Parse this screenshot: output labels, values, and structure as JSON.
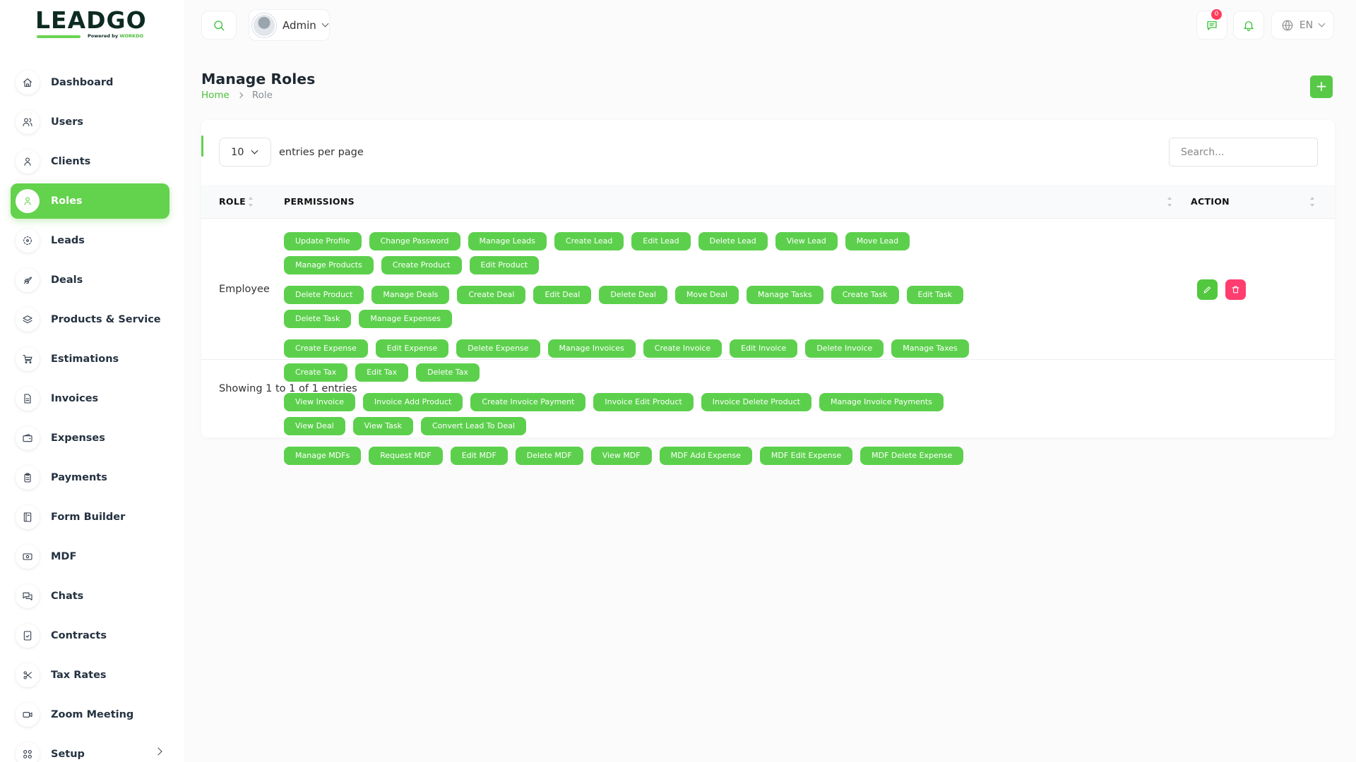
{
  "logo": {
    "brand": "LEADGO",
    "tagline_prefix": "Powered by ",
    "tagline_brand": "WORKDO"
  },
  "header": {
    "user_name": "Admin",
    "message_count": "0",
    "language": "EN"
  },
  "sidebar": {
    "items": [
      {
        "label": "Dashboard",
        "icon": "home-icon"
      },
      {
        "label": "Users",
        "icon": "users-icon"
      },
      {
        "label": "Clients",
        "icon": "user-icon"
      },
      {
        "label": "Roles",
        "icon": "user-check-icon",
        "active": true
      },
      {
        "label": "Leads",
        "icon": "target-icon"
      },
      {
        "label": "Deals",
        "icon": "rocket-icon"
      },
      {
        "label": "Products & Service",
        "icon": "layers-icon"
      },
      {
        "label": "Estimations",
        "icon": "cart-icon"
      },
      {
        "label": "Invoices",
        "icon": "file-icon"
      },
      {
        "label": "Expenses",
        "icon": "wallet-icon"
      },
      {
        "label": "Payments",
        "icon": "clipboard-icon"
      },
      {
        "label": "Form Builder",
        "icon": "book-icon"
      },
      {
        "label": "MDF",
        "icon": "money-icon"
      },
      {
        "label": "Chats",
        "icon": "chat-icon"
      },
      {
        "label": "Contracts",
        "icon": "contract-icon"
      },
      {
        "label": "Tax Rates",
        "icon": "scissors-icon"
      },
      {
        "label": "Zoom Meeting",
        "icon": "video-icon"
      },
      {
        "label": "Setup",
        "icon": "grid-icon"
      }
    ]
  },
  "page": {
    "title": "Manage Roles",
    "breadcrumb_home": "Home",
    "breadcrumb_current": "Role",
    "add_label": "+"
  },
  "table": {
    "page_size": "10",
    "entries_label": "entries per page",
    "search_placeholder": "Search...",
    "columns": [
      "ROLE",
      "PERMISSIONS",
      "ACTION"
    ],
    "rows": [
      {
        "role": "Employee",
        "permissions": [
          "Update Profile",
          "Change Password",
          "Manage Leads",
          "Create Lead",
          "Edit Lead",
          "Delete Lead",
          "View Lead",
          "Move Lead",
          "Manage Products",
          "Create Product",
          "Edit Product",
          "Delete Product",
          "Manage Deals",
          "Create Deal",
          "Edit Deal",
          "Delete Deal",
          "Move Deal",
          "Manage Tasks",
          "Create Task",
          "Edit Task",
          "Delete Task",
          "Manage Expenses",
          "Create Expense",
          "Edit Expense",
          "Delete Expense",
          "Manage Invoices",
          "Create Invoice",
          "Edit Invoice",
          "Delete Invoice",
          "Manage Taxes",
          "Create Tax",
          "Edit Tax",
          "Delete Tax",
          "View Invoice",
          "Invoice Add Product",
          "Create Invoice Payment",
          "Invoice Edit Product",
          "Invoice Delete Product",
          "Manage Invoice Payments",
          "View Deal",
          "View Task",
          "Convert Lead To Deal",
          "Manage MDFs",
          "Request MDF",
          "Edit MDF",
          "Delete MDF",
          "View MDF",
          "MDF Add Expense",
          "MDF Edit Expense",
          "MDF Delete Expense"
        ]
      }
    ],
    "footer": "Showing 1 to 1 of 1 entries"
  },
  "colors": {
    "accent": "#63d24c",
    "danger": "#ff3d6e"
  }
}
